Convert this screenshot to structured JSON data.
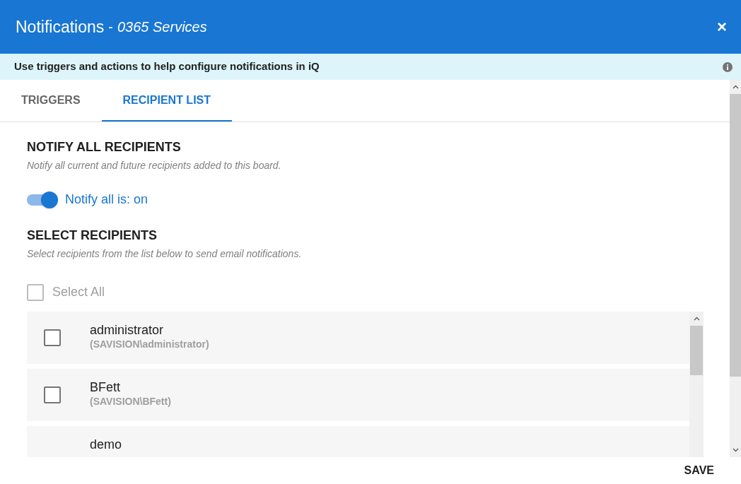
{
  "header": {
    "title": "Notifications",
    "separator": "-",
    "subtitle": "0365 Services",
    "close": "×"
  },
  "info_bar": {
    "text": "Use triggers and actions to help configure notifications in iQ"
  },
  "tabs": [
    {
      "label": "TRIGGERS",
      "selected": false
    },
    {
      "label": "RECIPIENT LIST",
      "selected": true
    }
  ],
  "notify_all": {
    "heading": "NOTIFY ALL RECIPIENTS",
    "description": "Notify all current and future recipients added to this board.",
    "toggle_label": "Notify all is: on",
    "on": true
  },
  "select_recipients": {
    "heading": "SELECT RECIPIENTS",
    "description": "Select recipients from the list below to send email notifications.",
    "select_all": {
      "label": "Select All",
      "checked": false,
      "disabled": true
    }
  },
  "recipients": [
    {
      "name": "administrator",
      "account": "(SAVISION\\administrator)",
      "checked": false
    },
    {
      "name": "BFett",
      "account": "(SAVISION\\BFett)",
      "checked": false
    },
    {
      "name": "demo"
    }
  ],
  "footer": {
    "save": "SAVE"
  }
}
